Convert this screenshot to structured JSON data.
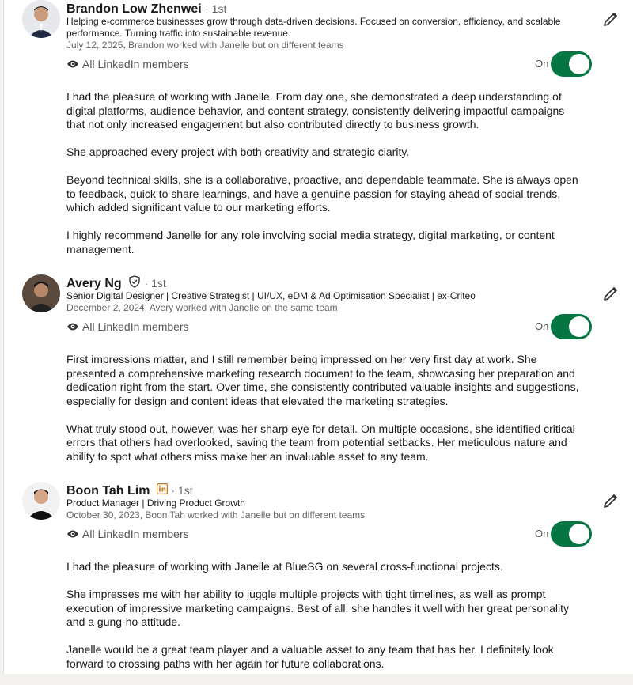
{
  "visibility_label": "All LinkedIn members",
  "toggle_label": "On",
  "recommendations": [
    {
      "name": "Brandon Low Zhenwei",
      "degree": "· 1st",
      "headline": "Helping e-commerce businesses grow through data-driven decisions. Focused on conversion, efficiency, and scalable performance. Turning traffic into sustainable revenue.",
      "meta": "July 12, 2025, Brandon worked with Janelle but on different teams",
      "paragraphs": [
        "I had the pleasure of working with Janelle. From day one, she demonstrated a deep understanding of digital platforms, audience behavior, and content strategy, consistently delivering impactful campaigns that not only increased engagement but also contributed directly to business growth.",
        "She approached every project with both creativity and strategic clarity.",
        "Beyond technical skills, she is a collaborative, proactive, and dependable teammate. She is always open to feedback, quick to share learnings, and have a genuine passion for staying ahead of social trends, which added significant value to our marketing efforts.",
        "I highly recommend Janelle for any role involving social media strategy, digital marketing, or content management."
      ]
    },
    {
      "name": "Avery Ng",
      "degree": "· 1st",
      "headline": "Senior Digital Designer | Creative Strategist | UI/UX, eDM & Ad Optimisation Specialist | ex-Criteo",
      "meta": "December 2, 2024, Avery worked with Janelle on the same team",
      "paragraphs": [
        "First impressions matter, and I still remember being impressed on her very first day at work. She presented a comprehensive marketing research document to the team, showcasing her preparation and dedication right from the start. Over time, she consistently contributed valuable insights and suggestions, especially for design and content ideas that elevated the marketing strategies.",
        "What truly stood out, however, was her sharp eye for detail. On multiple occasions, she identified critical errors that others had overlooked, saving the team from potential setbacks. Her meticulous nature and ability to spot what others miss make her an invaluable asset to any team."
      ]
    },
    {
      "name": "Boon Tah Lim",
      "degree": "· 1st",
      "headline": "Product Manager | Driving Product Growth",
      "meta": "October 30, 2023, Boon Tah worked with Janelle but on different teams",
      "paragraphs": [
        "I had the pleasure of working with Janelle at BlueSG on several cross-functional projects.",
        "She impresses me with her ability to juggle multiple projects with tight timelines, as well as prompt execution of impressive marketing campaigns. Best of all, she handles it well with her great personality and a gung-ho attitude.",
        "Janelle would be a great team player and a valuable asset to any team that has her. I definitely look forward to crossing paths with her again for future collaborations."
      ]
    }
  ],
  "colors": {
    "toggle_on": "#057642",
    "premium_badge": "#c37d16"
  }
}
